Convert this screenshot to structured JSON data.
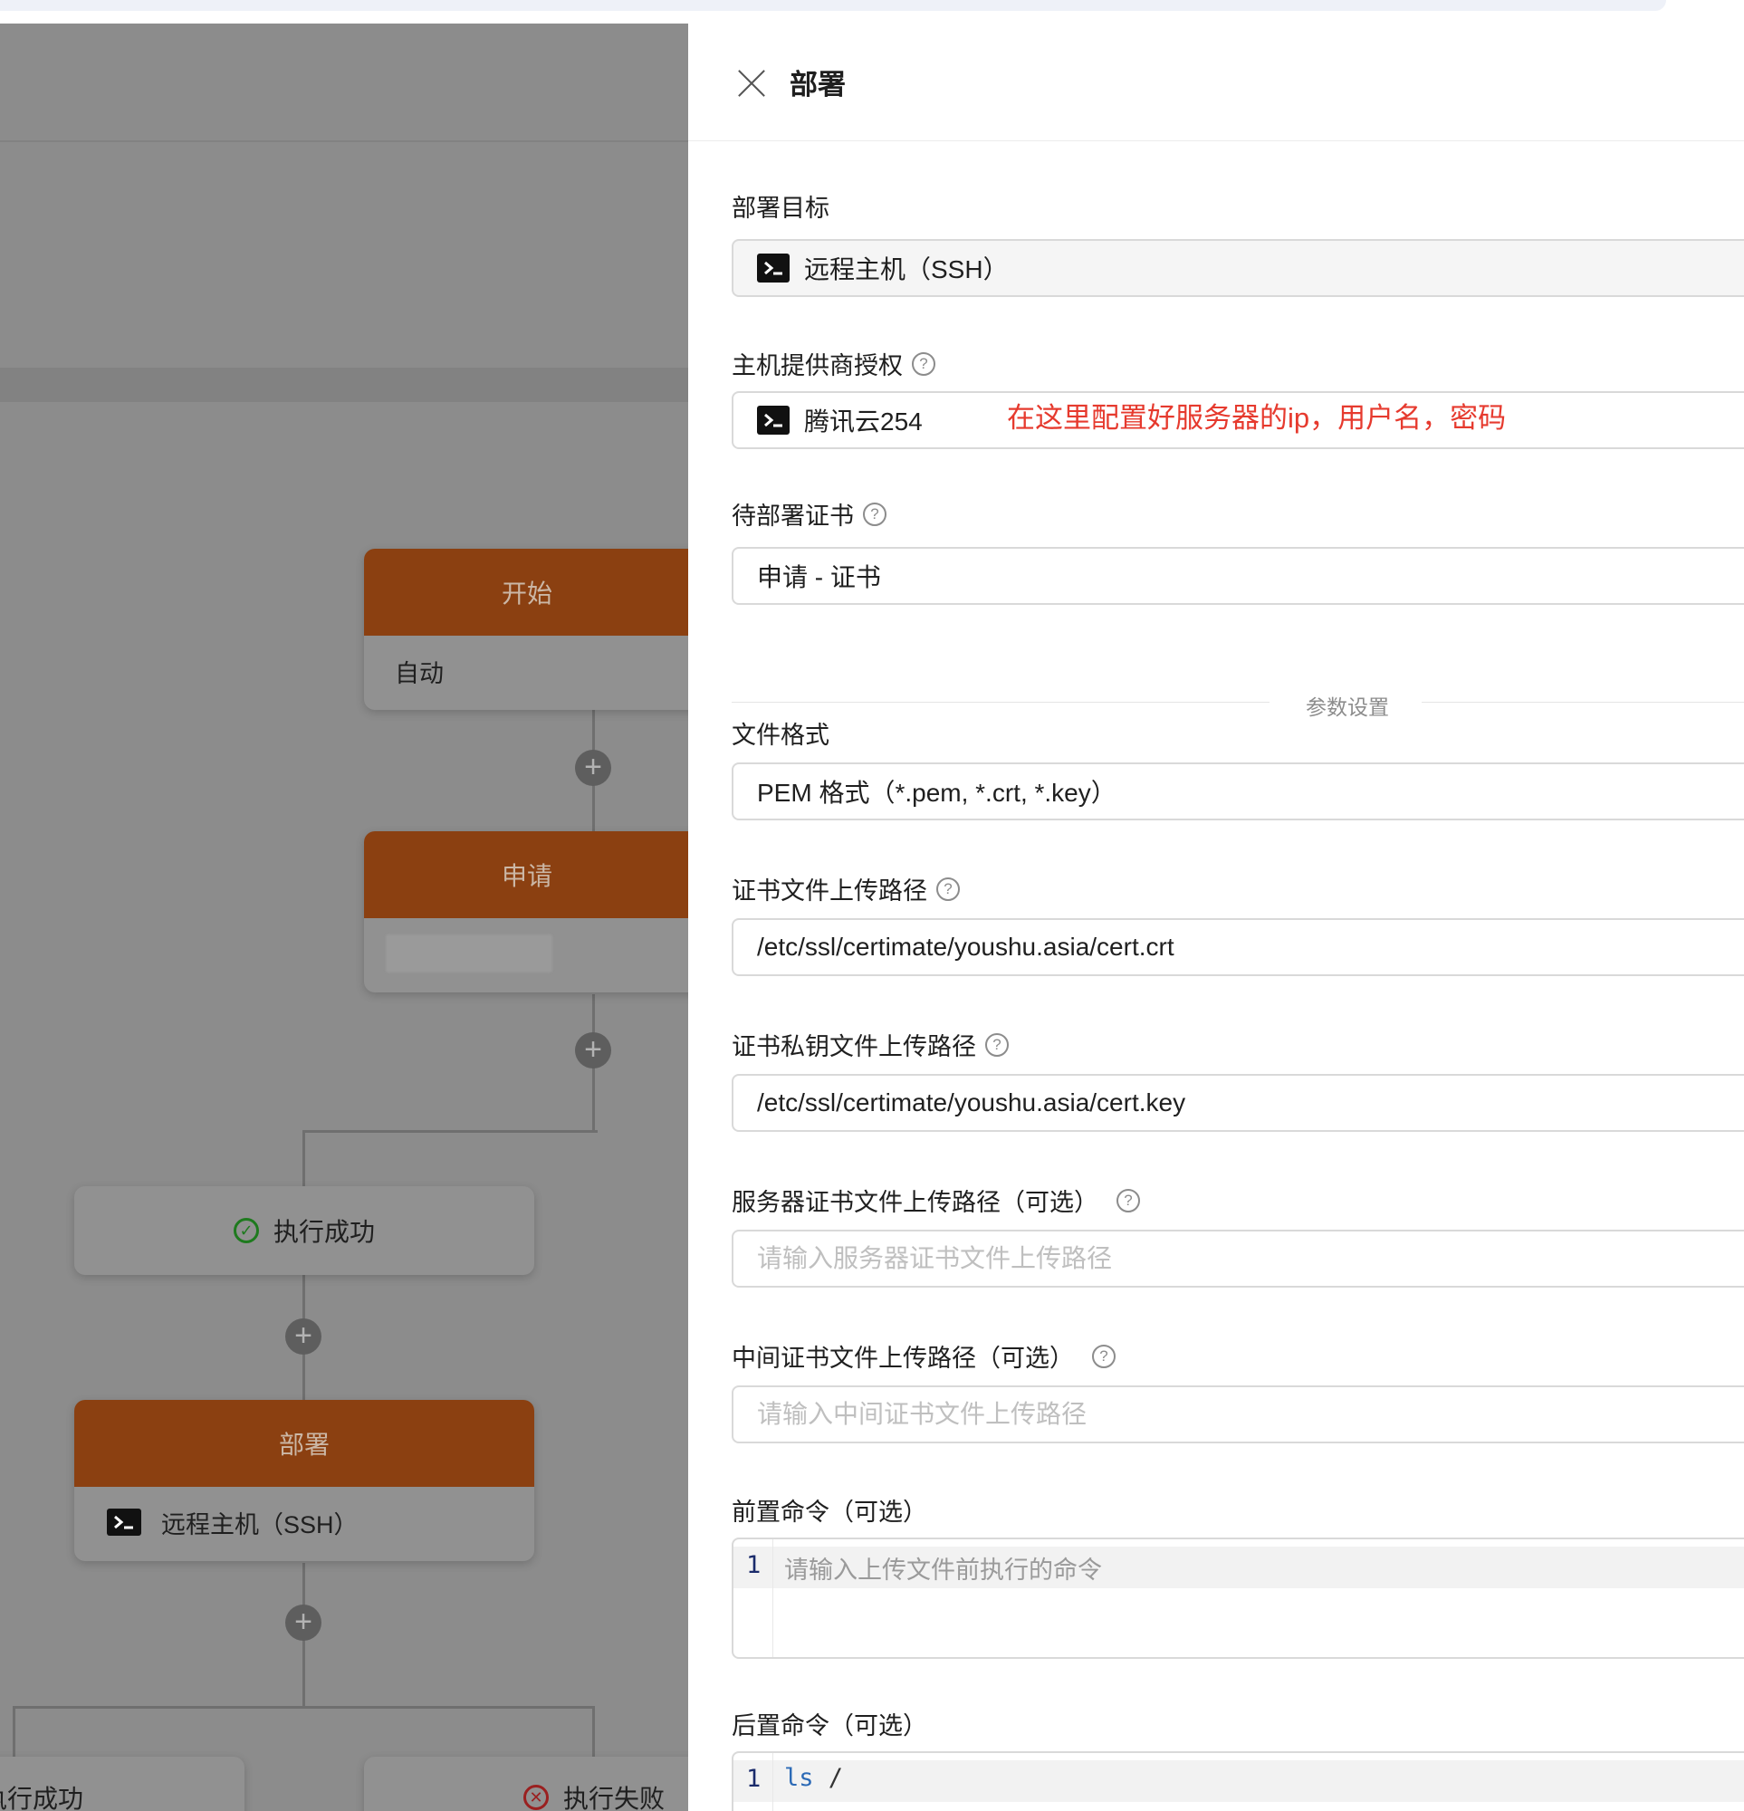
{
  "canvas": {
    "start_node": {
      "title": "开始",
      "body": "自动"
    },
    "apply_node": {
      "title": "申请"
    },
    "branch_success": {
      "label": "执行成功"
    },
    "deploy_node": {
      "title": "部署",
      "body": "远程主机（SSH）"
    },
    "bottom_left": {
      "label": "执行成功"
    },
    "bottom_right": {
      "label": "执行失败"
    },
    "add_symbol": "+"
  },
  "drawer": {
    "title": "部署",
    "deploy_target": {
      "label": "部署目标",
      "value": "远程主机（SSH）",
      "icon": "terminal-icon"
    },
    "provider_auth": {
      "label": "主机提供商授权",
      "value": "腾讯云254",
      "icon": "terminal-icon"
    },
    "annotation": "在这里配置好服务器的ip，用户名，密码",
    "pending_cert": {
      "label": "待部署证书",
      "value": "申请 - 证书"
    },
    "divider_text": "参数设置",
    "file_format": {
      "label": "文件格式",
      "value": "PEM 格式（*.pem, *.crt, *.key）"
    },
    "cert_path": {
      "label": "证书文件上传路径",
      "value": "/etc/ssl/certimate/youshu.asia/cert.crt"
    },
    "key_path": {
      "label": "证书私钥文件上传路径",
      "value": "/etc/ssl/certimate/youshu.asia/cert.key"
    },
    "server_cert_path": {
      "label": "服务器证书文件上传路径（可选）",
      "placeholder": "请输入服务器证书文件上传路径"
    },
    "intermediate_cert_path": {
      "label": "中间证书文件上传路径（可选）",
      "placeholder": "请输入中间证书文件上传路径"
    },
    "pre_command": {
      "label": "前置命令（可选）",
      "line_number": "1",
      "placeholder": "请输入上传文件前执行的命令"
    },
    "post_command": {
      "label": "后置命令（可选）",
      "line_number": "1",
      "code_cmd": "ls",
      "code_arg": " /"
    }
  },
  "colors": {
    "node_header": "#8b4011",
    "annotation": "#e63a2e",
    "overlay": "#8c8c8c"
  }
}
